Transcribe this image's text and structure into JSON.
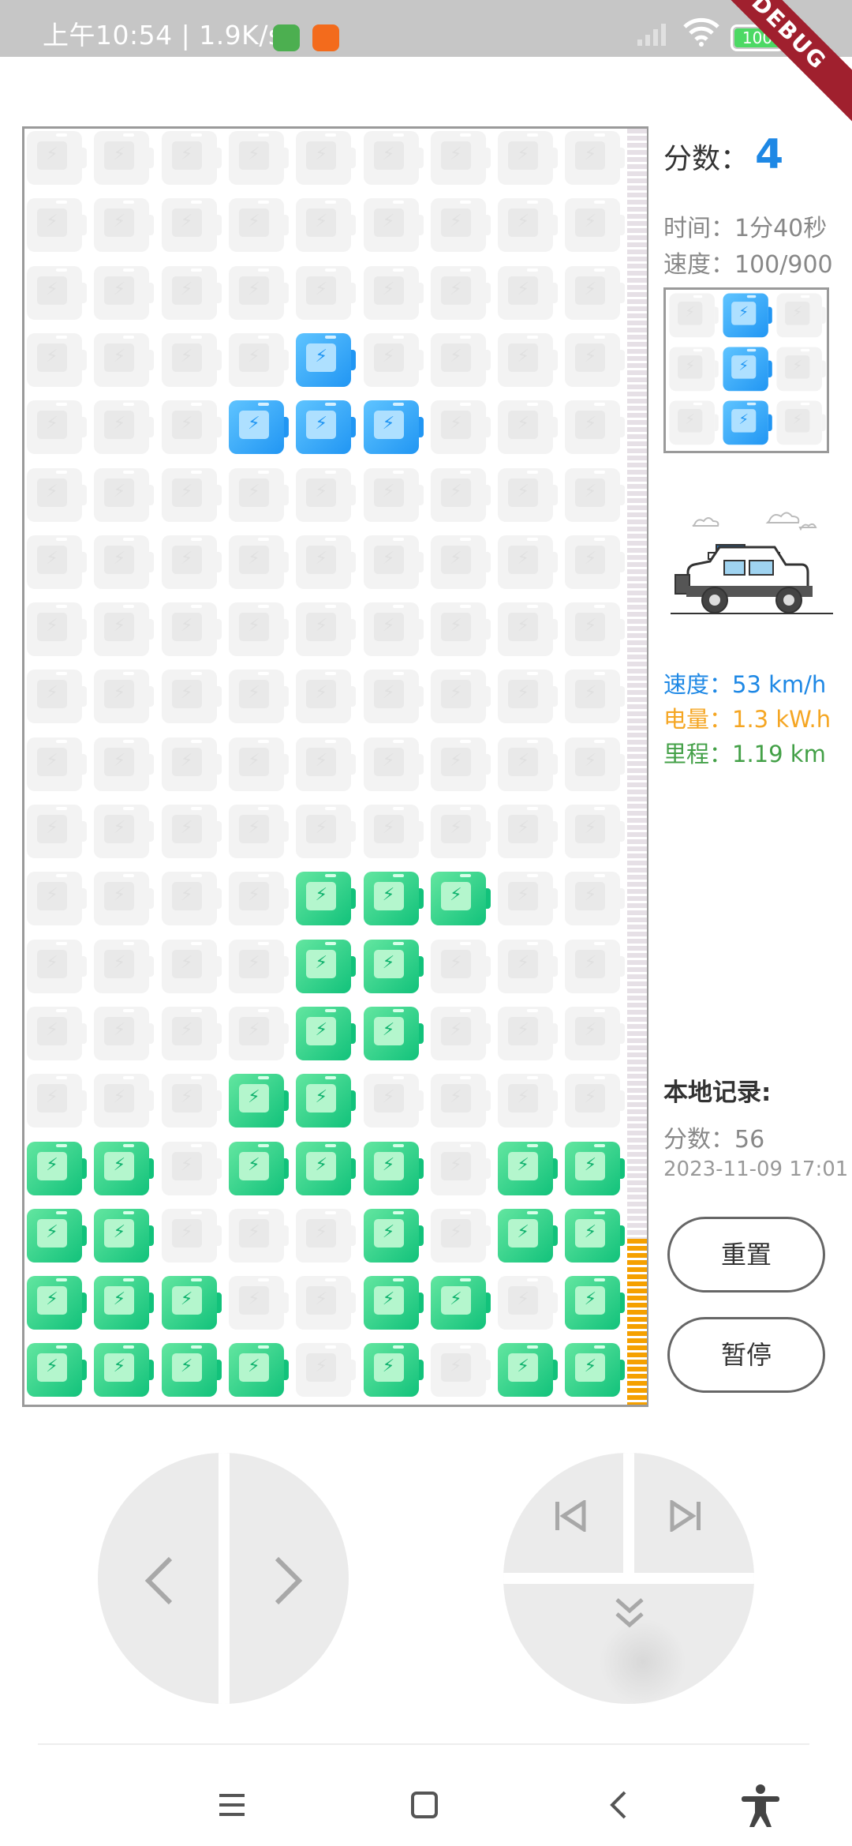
{
  "status_bar": {
    "time": "上午10:54 | 1.9K/s",
    "battery": "100",
    "debug_label": "DEBUG"
  },
  "board": {
    "cols": 9,
    "rows": 19,
    "active_blue": [
      [
        3,
        4
      ],
      [
        4,
        3
      ],
      [
        4,
        4
      ],
      [
        4,
        5
      ]
    ],
    "filled_green": [
      [
        11,
        4
      ],
      [
        11,
        5
      ],
      [
        11,
        6
      ],
      [
        12,
        4
      ],
      [
        12,
        5
      ],
      [
        13,
        4
      ],
      [
        13,
        5
      ],
      [
        14,
        3
      ],
      [
        14,
        4
      ],
      [
        15,
        0
      ],
      [
        15,
        1
      ],
      [
        15,
        3
      ],
      [
        15,
        4
      ],
      [
        15,
        5
      ],
      [
        15,
        7
      ],
      [
        15,
        8
      ],
      [
        16,
        0
      ],
      [
        16,
        1
      ],
      [
        16,
        5
      ],
      [
        16,
        7
      ],
      [
        16,
        8
      ],
      [
        17,
        0
      ],
      [
        17,
        1
      ],
      [
        17,
        2
      ],
      [
        17,
        5
      ],
      [
        17,
        6
      ],
      [
        17,
        8
      ],
      [
        18,
        0
      ],
      [
        18,
        1
      ],
      [
        18,
        2
      ],
      [
        18,
        3
      ],
      [
        18,
        5
      ],
      [
        18,
        7
      ],
      [
        18,
        8
      ]
    ],
    "progress_fraction": 0.13
  },
  "side": {
    "score_label": "分数：",
    "score_value": "4",
    "time_text": "时间：1分40秒",
    "speed_level_text": "速度：100/900",
    "next_piece": [
      [
        0,
        1
      ],
      [
        1,
        1
      ],
      [
        2,
        1
      ]
    ],
    "car_icon": "jeep-icon",
    "speed_text": "速度：53 km/h",
    "energy_text": "电量：1.3 kW.h",
    "mileage_text": "里程：1.19 km",
    "record_title": "本地记录:",
    "record_score": "分数：56",
    "record_date": "2023-11-09 17:01",
    "reset_label": "重置",
    "pause_label": "暂停"
  },
  "colors": {
    "active": "#2196f3",
    "filled": "#12c27b",
    "speed": "#1e88e5",
    "energy": "#f5a623",
    "mileage": "#43a047",
    "progress": "#f5a000"
  },
  "controls": {
    "left_icon": "chevron-left-icon",
    "right_icon": "chevron-right-icon",
    "rotate_left_icon": "skip-previous-icon",
    "rotate_right_icon": "skip-next-icon",
    "drop_icon": "double-chevron-down-icon"
  },
  "nav": {
    "menu_icon": "menu-icon",
    "home_icon": "home-square-icon",
    "back_icon": "back-icon",
    "accessibility_icon": "accessibility-icon"
  }
}
